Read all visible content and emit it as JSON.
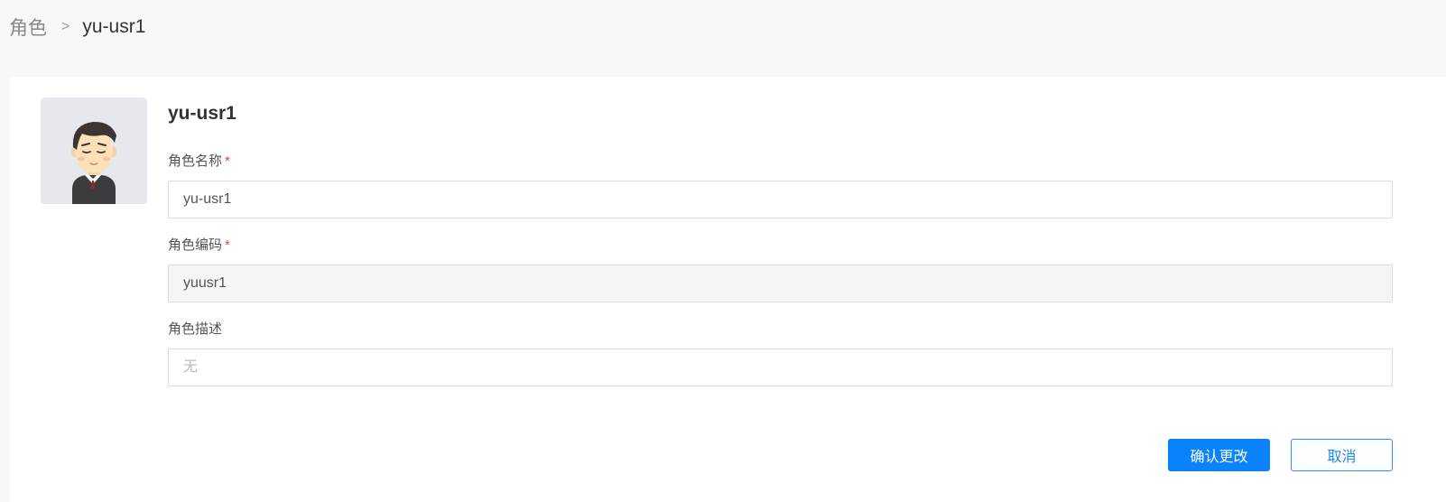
{
  "breadcrumb": {
    "parent": "角色",
    "separator": ">",
    "current": "yu-usr1"
  },
  "avatar": {
    "icon": "user-avatar-icon"
  },
  "role": {
    "title": "yu-usr1"
  },
  "form": {
    "name": {
      "label": "角色名称",
      "required_mark": "*",
      "value": "yu-usr1"
    },
    "code": {
      "label": "角色编码",
      "required_mark": "*",
      "value": "yuusr1"
    },
    "description": {
      "label": "角色描述",
      "value": "",
      "placeholder": "无"
    }
  },
  "actions": {
    "confirm_label": "确认更改",
    "cancel_label": "取消"
  },
  "colors": {
    "primary": "#0a82f9",
    "required": "#e2474c",
    "page_bg": "#f8f8f8"
  }
}
